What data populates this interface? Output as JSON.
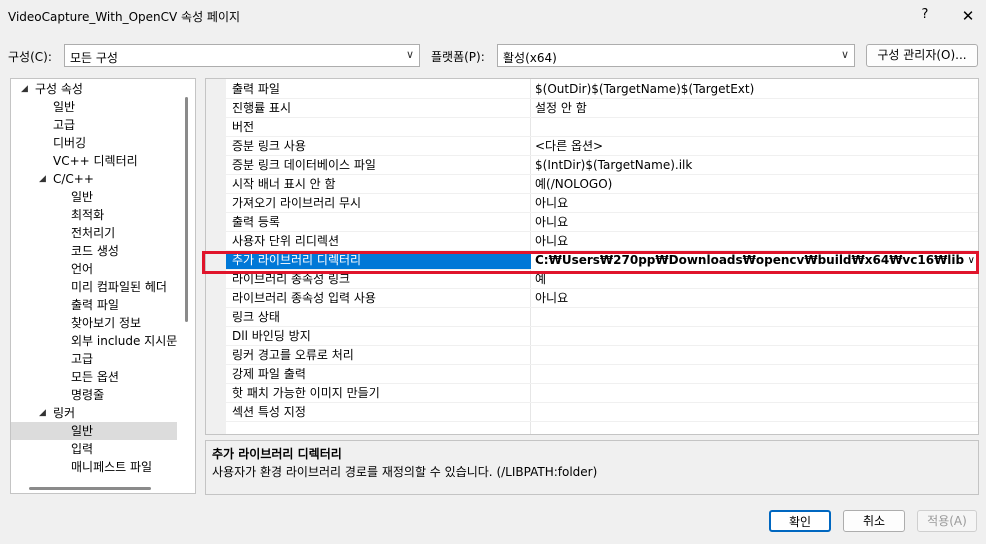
{
  "window": {
    "title": "VideoCapture_With_OpenCV 속성 페이지",
    "help_label": "?",
    "close_label": "✕"
  },
  "config_bar": {
    "config_label": "구성(C):",
    "config_value": "모든 구성",
    "platform_label": "플랫폼(P):",
    "platform_value": "활성(x64)",
    "manager_button": "구성 관리자(O)..."
  },
  "tree": {
    "items": [
      {
        "label": "구성 속성",
        "expanded": true,
        "selected": false
      },
      {
        "label": "일반",
        "selected": false
      },
      {
        "label": "고급",
        "selected": false
      },
      {
        "label": "디버깅",
        "selected": false
      },
      {
        "label": "VC++ 디렉터리",
        "selected": false
      },
      {
        "label": "C/C++",
        "expanded": true,
        "selected": false
      },
      {
        "label": "일반",
        "selected": false
      },
      {
        "label": "최적화",
        "selected": false
      },
      {
        "label": "전처리기",
        "selected": false
      },
      {
        "label": "코드 생성",
        "selected": false
      },
      {
        "label": "언어",
        "selected": false
      },
      {
        "label": "미리 컴파일된 헤더",
        "selected": false
      },
      {
        "label": "출력 파일",
        "selected": false
      },
      {
        "label": "찾아보기 정보",
        "selected": false
      },
      {
        "label": "외부 include 지시문",
        "selected": false
      },
      {
        "label": "고급",
        "selected": false
      },
      {
        "label": "모든 옵션",
        "selected": false
      },
      {
        "label": "명령줄",
        "selected": false
      },
      {
        "label": "링커",
        "expanded": true,
        "selected": false
      },
      {
        "label": "일반",
        "selected": true
      },
      {
        "label": "입력",
        "selected": false
      },
      {
        "label": "매니페스트 파일",
        "selected": false
      }
    ]
  },
  "properties": [
    {
      "name": "출력 파일",
      "value": "$(OutDir)$(TargetName)$(TargetExt)"
    },
    {
      "name": "진행률 표시",
      "value": "설정 안 함"
    },
    {
      "name": "버전",
      "value": ""
    },
    {
      "name": "증분 링크 사용",
      "value": "<다른 옵션>"
    },
    {
      "name": "증분 링크 데이터베이스 파일",
      "value": "$(IntDir)$(TargetName).ilk"
    },
    {
      "name": "시작 배너 표시 안 함",
      "value": "예(/NOLOGO)"
    },
    {
      "name": "가져오기 라이브러리 무시",
      "value": "아니요"
    },
    {
      "name": "출력 등록",
      "value": "아니요"
    },
    {
      "name": "사용자 단위 리디렉션",
      "value": "아니요"
    },
    {
      "name": "추가 라이브러리 디렉터리",
      "value": "C:₩Users₩270pp₩Downloads₩opencv₩build₩x64₩vc16₩lib"
    },
    {
      "name": "라이브러리 종속성 링크",
      "value": "예"
    },
    {
      "name": "라이브러리 종속성 입력 사용",
      "value": "아니요"
    },
    {
      "name": "링크 상태",
      "value": ""
    },
    {
      "name": "Dll 바인딩 방지",
      "value": ""
    },
    {
      "name": "링커 경고를 오류로 처리",
      "value": ""
    },
    {
      "name": "강제 파일 출력",
      "value": ""
    },
    {
      "name": "핫 패치 가능한 이미지 만들기",
      "value": ""
    },
    {
      "name": "섹션 특성 지정",
      "value": ""
    }
  ],
  "selected_property_index": 9,
  "description": {
    "title": "추가 라이브러리 디렉터리",
    "text": "사용자가 환경 라이브러리 경로를 재정의할 수 있습니다. (/LIBPATH:folder)"
  },
  "buttons": {
    "ok": "확인",
    "cancel": "취소",
    "apply": "적용(A)"
  },
  "colors": {
    "selection": "#0078d7",
    "highlight_border": "#e0142b"
  }
}
